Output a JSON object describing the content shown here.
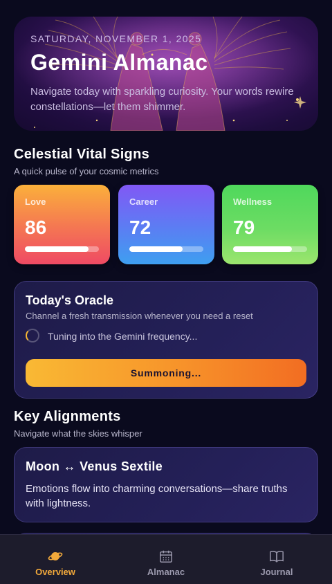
{
  "hero": {
    "date": "Saturday, November 1, 2025",
    "title": "Gemini Almanac",
    "description": "Navigate today with sparkling curiosity. Your words rewire constellations—let them shimmer."
  },
  "vitals": {
    "title": "Celestial Vital Signs",
    "subtitle": "A quick pulse of your cosmic metrics",
    "metrics": [
      {
        "label": "Love",
        "value": "86",
        "progress": 0.86
      },
      {
        "label": "Career",
        "value": "72",
        "progress": 0.72
      },
      {
        "label": "Wellness",
        "value": "79",
        "progress": 0.79
      }
    ]
  },
  "oracle": {
    "title": "Today's Oracle",
    "subtitle": "Channel a fresh transmission whenever you need a reset",
    "status": "Tuning into the Gemini frequency...",
    "button_label": "Summoning..."
  },
  "alignments": {
    "title": "Key Alignments",
    "subtitle": "Navigate what the skies whisper",
    "items": [
      {
        "title": "Moon ↔ Venus Sextile",
        "description": "Emotions flow into charming conversations—share truths with lightness."
      }
    ]
  },
  "nav": {
    "items": [
      {
        "label": "Overview",
        "icon": "planet-icon",
        "active": true
      },
      {
        "label": "Almanac",
        "icon": "calendar-icon",
        "active": false
      },
      {
        "label": "Journal",
        "icon": "book-icon",
        "active": false
      }
    ]
  },
  "colors": {
    "background": "#0a0a1e",
    "accent": "#f2a93b",
    "love_gradient": [
      "#fbb03b",
      "#ef4a64"
    ],
    "career_gradient": [
      "#8158f5",
      "#3e9ff0"
    ],
    "wellness_gradient": [
      "#4fd85c",
      "#9ce56e"
    ]
  }
}
